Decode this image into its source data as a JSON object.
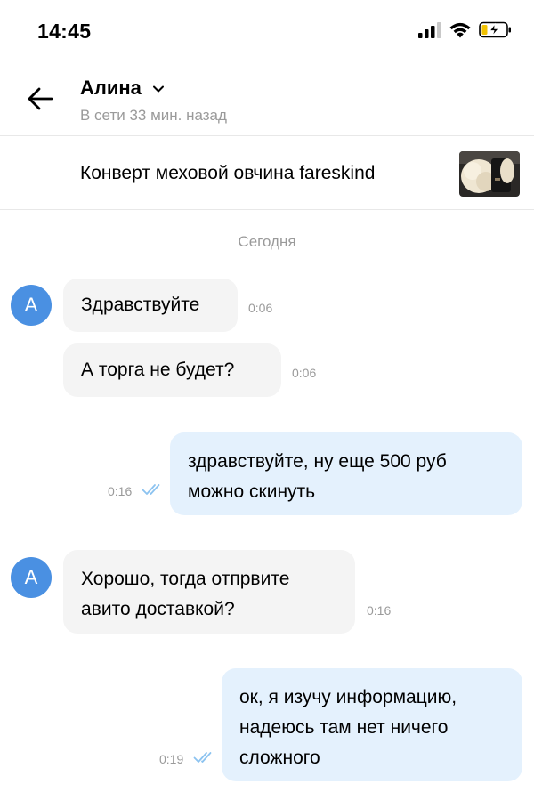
{
  "status_bar": {
    "time": "14:45",
    "icons": [
      "cellular-signal-icon",
      "wifi-icon",
      "battery-charging-icon"
    ]
  },
  "header": {
    "back_icon": "arrow-left-icon",
    "contact_name": "Алина",
    "contact_status": "В сети 33 мин. назад"
  },
  "listing": {
    "title": "Конверт меховой овчина fareskind",
    "thumbnail": "product-photo"
  },
  "chat": {
    "date_separator": "Сегодня",
    "avatar_letter": "А",
    "messages": [
      {
        "direction": "in",
        "text": "Здравствуйте",
        "time": "0:06"
      },
      {
        "direction": "in",
        "text": "А торга не будет?",
        "time": "0:06"
      },
      {
        "direction": "out",
        "lines": [
          "здравствуйте, ну еще 500 руб",
          "можно скинуть"
        ],
        "time": "0:16",
        "read": true
      },
      {
        "direction": "in",
        "lines": [
          "Хорошо, тогда отпрвите",
          "авито доставкой?"
        ],
        "time": "0:16"
      },
      {
        "direction": "out",
        "lines": [
          "ок, я изучу информацию,",
          "надеюсь там нет ничего",
          "сложного"
        ],
        "time": "0:19",
        "read": true
      }
    ]
  },
  "colors": {
    "accent": "#4a90e2",
    "incoming_bubble": "#f4f4f4",
    "outgoing_bubble": "#e4f1fd",
    "secondary_text": "#9a9a9a",
    "read_ticks": "#8cc3f0"
  }
}
